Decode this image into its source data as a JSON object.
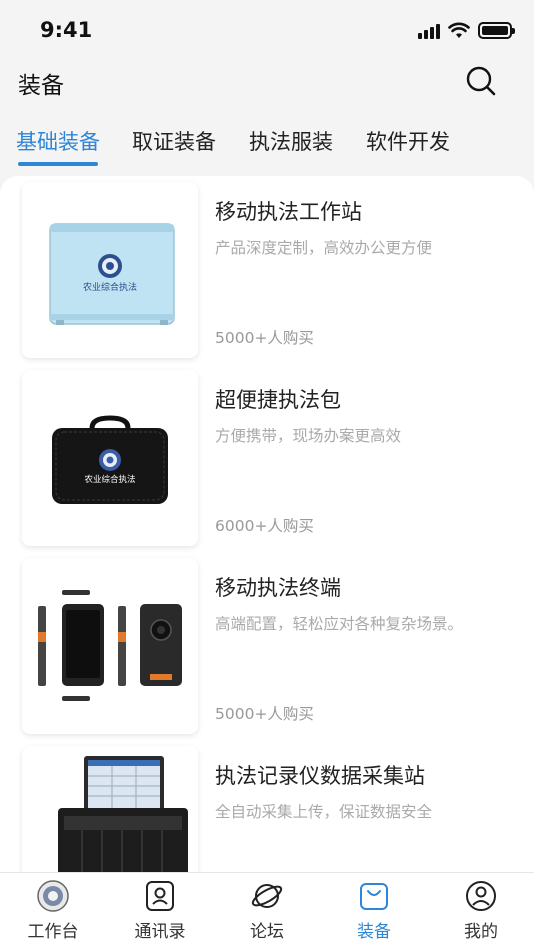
{
  "status_bar": {
    "time": "9:41"
  },
  "header": {
    "title": "装备"
  },
  "tabs": [
    {
      "label": "基础装备",
      "active": true
    },
    {
      "label": "取证装备",
      "active": false
    },
    {
      "label": "执法服装",
      "active": false
    },
    {
      "label": "软件开发",
      "active": false
    }
  ],
  "products": [
    {
      "title": "移动执法工作站",
      "desc": "产品深度定制，高效办公更方便",
      "sales": "5000+人购买",
      "image_text": "农业综合执法"
    },
    {
      "title": "超便捷执法包",
      "desc": "方便携带，现场办案更高效",
      "sales": "6000+人购买",
      "image_text": "农业综合执法"
    },
    {
      "title": "移动执法终端",
      "desc": "高端配置，轻松应对各种复杂场景。",
      "sales": "5000+人购买",
      "image_text": ""
    },
    {
      "title": "执法记录仪数据采集站",
      "desc": "全自动采集上传，保证数据安全",
      "sales": "",
      "image_text": ""
    }
  ],
  "tabbar": [
    {
      "label": "工作台",
      "icon": "emblem-icon",
      "active": false
    },
    {
      "label": "通讯录",
      "icon": "contacts-icon",
      "active": false
    },
    {
      "label": "论坛",
      "icon": "planet-icon",
      "active": false
    },
    {
      "label": "装备",
      "icon": "bag-icon",
      "active": true
    },
    {
      "label": "我的",
      "icon": "profile-icon",
      "active": false
    }
  ],
  "colors": {
    "accent": "#2f86d6",
    "text": "#222222",
    "muted": "#aaaaaa",
    "background": "#f4f4f4"
  }
}
